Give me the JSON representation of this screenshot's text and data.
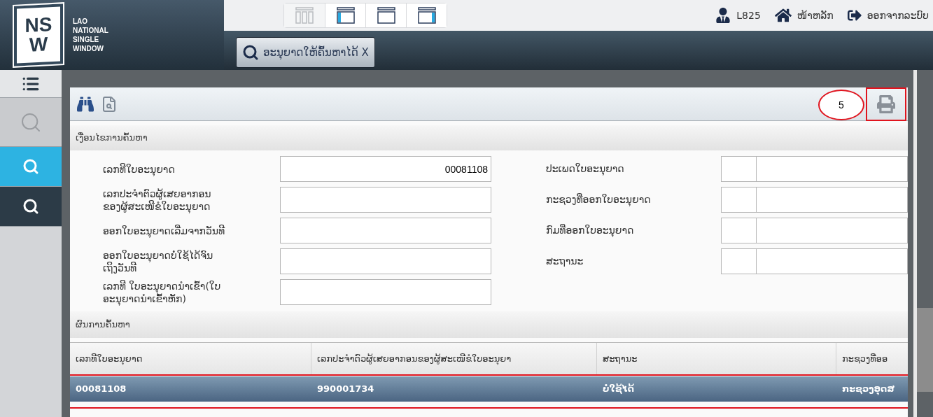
{
  "header": {
    "logo": {
      "mark": "NSW",
      "lines": [
        "LAO",
        "NATIONAL",
        "SINGLE",
        "WINDOW"
      ]
    },
    "layouts": [
      {
        "kind": "columns",
        "selected": true
      },
      {
        "kind": "left-panel",
        "selected": false
      },
      {
        "kind": "plain",
        "selected": false
      },
      {
        "kind": "right-panel",
        "selected": false
      }
    ],
    "user_menu": [
      {
        "kind": "user",
        "label": "L825"
      },
      {
        "kind": "home",
        "label": "ໜ້າຫລັກ"
      },
      {
        "kind": "logout",
        "label": "ອອກຈາກລະບົບ"
      }
    ],
    "open_tab": {
      "label": "ອະນຸຍາດໃຫ້ຄົ້ນຫາໄດ້ X"
    }
  },
  "sidebar": {
    "items": [
      {
        "kind": "menu",
        "selected": false,
        "disabled": false
      },
      {
        "kind": "search",
        "selected": false,
        "disabled": true
      },
      {
        "kind": "search",
        "selected": true,
        "disabled": false
      },
      {
        "kind": "search",
        "selected": false,
        "disabled": false
      }
    ]
  },
  "toolbar": {
    "print_highlighted": true,
    "callout": "5"
  },
  "search_section": {
    "title": "ເງື່ອນໄຂການຄົ້ນຫາ",
    "left_fields": [
      {
        "label": "ເລກທີໃບອະນຸຍາດ",
        "value": "00081108"
      },
      {
        "label": "ເລກປະຈຳຕົວຜູ້ເສຍອາກອນ ຂອງຜູ້ສະເໜີຂໍໃບອະນຸຍາດ"
      },
      {
        "label": "ອອກໃບອະນຸຍາດເລີ່ມຈາກວັນທີ"
      },
      {
        "label": "ອອກໃບອະນຸຍາດບໍ່ໃຊ້ໄດ້ຈົນ ເຖິງວັນທີ"
      },
      {
        "label": "ເລກທີ ໃບອະນຸຍາດນຳເຂົ້າ(ໃບ ອະນຸຍາດນຳເຂົ້າຫັກ)"
      }
    ],
    "right_fields": [
      {
        "label": "ປະເພດໃບອະນຸຍາດ"
      },
      {
        "label": "ກະຊວງທີ່ອອກໃບອະນຸຍາດ"
      },
      {
        "label": "ກົມທີ່ອອກໃບອະນຸຍາດ"
      },
      {
        "label": "ສະຖານະ"
      }
    ]
  },
  "results_section": {
    "title": "ຜົນການຄົ້ນຫາ",
    "table": {
      "columns": [
        "ເລກທີໃບອະນຸຍາດ",
        "ເລກປະຈຳຕົວຜູ້ເສຍອາກອນຂອງຜູ້ສະເໜີຂໍໃບອະນຸຍາ",
        "ສະຖານະ",
        "ກະຊວງທີ່ອອ"
      ],
      "rows": [
        {
          "selected": true,
          "highlighted": true,
          "cells": [
            "00081108",
            "990001734",
            "ບໍ່ໃຊ້ໄດ້",
            "ກະຊວງອຸດສ"
          ]
        }
      ]
    }
  }
}
